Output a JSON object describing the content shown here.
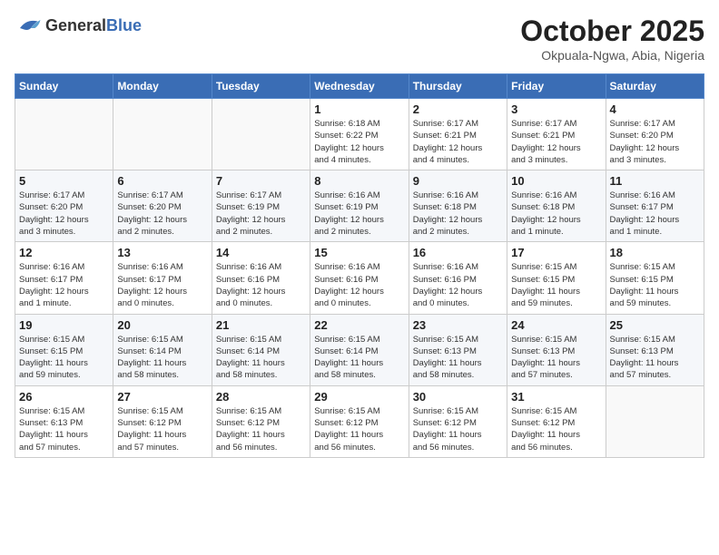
{
  "header": {
    "logo_general": "General",
    "logo_blue": "Blue",
    "month": "October 2025",
    "location": "Okpuala-Ngwa, Abia, Nigeria"
  },
  "weekdays": [
    "Sunday",
    "Monday",
    "Tuesday",
    "Wednesday",
    "Thursday",
    "Friday",
    "Saturday"
  ],
  "weeks": [
    [
      {
        "day": "",
        "info": ""
      },
      {
        "day": "",
        "info": ""
      },
      {
        "day": "",
        "info": ""
      },
      {
        "day": "1",
        "info": "Sunrise: 6:18 AM\nSunset: 6:22 PM\nDaylight: 12 hours\nand 4 minutes."
      },
      {
        "day": "2",
        "info": "Sunrise: 6:17 AM\nSunset: 6:21 PM\nDaylight: 12 hours\nand 4 minutes."
      },
      {
        "day": "3",
        "info": "Sunrise: 6:17 AM\nSunset: 6:21 PM\nDaylight: 12 hours\nand 3 minutes."
      },
      {
        "day": "4",
        "info": "Sunrise: 6:17 AM\nSunset: 6:20 PM\nDaylight: 12 hours\nand 3 minutes."
      }
    ],
    [
      {
        "day": "5",
        "info": "Sunrise: 6:17 AM\nSunset: 6:20 PM\nDaylight: 12 hours\nand 3 minutes."
      },
      {
        "day": "6",
        "info": "Sunrise: 6:17 AM\nSunset: 6:20 PM\nDaylight: 12 hours\nand 2 minutes."
      },
      {
        "day": "7",
        "info": "Sunrise: 6:17 AM\nSunset: 6:19 PM\nDaylight: 12 hours\nand 2 minutes."
      },
      {
        "day": "8",
        "info": "Sunrise: 6:16 AM\nSunset: 6:19 PM\nDaylight: 12 hours\nand 2 minutes."
      },
      {
        "day": "9",
        "info": "Sunrise: 6:16 AM\nSunset: 6:18 PM\nDaylight: 12 hours\nand 2 minutes."
      },
      {
        "day": "10",
        "info": "Sunrise: 6:16 AM\nSunset: 6:18 PM\nDaylight: 12 hours\nand 1 minute."
      },
      {
        "day": "11",
        "info": "Sunrise: 6:16 AM\nSunset: 6:17 PM\nDaylight: 12 hours\nand 1 minute."
      }
    ],
    [
      {
        "day": "12",
        "info": "Sunrise: 6:16 AM\nSunset: 6:17 PM\nDaylight: 12 hours\nand 1 minute."
      },
      {
        "day": "13",
        "info": "Sunrise: 6:16 AM\nSunset: 6:17 PM\nDaylight: 12 hours\nand 0 minutes."
      },
      {
        "day": "14",
        "info": "Sunrise: 6:16 AM\nSunset: 6:16 PM\nDaylight: 12 hours\nand 0 minutes."
      },
      {
        "day": "15",
        "info": "Sunrise: 6:16 AM\nSunset: 6:16 PM\nDaylight: 12 hours\nand 0 minutes."
      },
      {
        "day": "16",
        "info": "Sunrise: 6:16 AM\nSunset: 6:16 PM\nDaylight: 12 hours\nand 0 minutes."
      },
      {
        "day": "17",
        "info": "Sunrise: 6:15 AM\nSunset: 6:15 PM\nDaylight: 11 hours\nand 59 minutes."
      },
      {
        "day": "18",
        "info": "Sunrise: 6:15 AM\nSunset: 6:15 PM\nDaylight: 11 hours\nand 59 minutes."
      }
    ],
    [
      {
        "day": "19",
        "info": "Sunrise: 6:15 AM\nSunset: 6:15 PM\nDaylight: 11 hours\nand 59 minutes."
      },
      {
        "day": "20",
        "info": "Sunrise: 6:15 AM\nSunset: 6:14 PM\nDaylight: 11 hours\nand 58 minutes."
      },
      {
        "day": "21",
        "info": "Sunrise: 6:15 AM\nSunset: 6:14 PM\nDaylight: 11 hours\nand 58 minutes."
      },
      {
        "day": "22",
        "info": "Sunrise: 6:15 AM\nSunset: 6:14 PM\nDaylight: 11 hours\nand 58 minutes."
      },
      {
        "day": "23",
        "info": "Sunrise: 6:15 AM\nSunset: 6:13 PM\nDaylight: 11 hours\nand 58 minutes."
      },
      {
        "day": "24",
        "info": "Sunrise: 6:15 AM\nSunset: 6:13 PM\nDaylight: 11 hours\nand 57 minutes."
      },
      {
        "day": "25",
        "info": "Sunrise: 6:15 AM\nSunset: 6:13 PM\nDaylight: 11 hours\nand 57 minutes."
      }
    ],
    [
      {
        "day": "26",
        "info": "Sunrise: 6:15 AM\nSunset: 6:13 PM\nDaylight: 11 hours\nand 57 minutes."
      },
      {
        "day": "27",
        "info": "Sunrise: 6:15 AM\nSunset: 6:12 PM\nDaylight: 11 hours\nand 57 minutes."
      },
      {
        "day": "28",
        "info": "Sunrise: 6:15 AM\nSunset: 6:12 PM\nDaylight: 11 hours\nand 56 minutes."
      },
      {
        "day": "29",
        "info": "Sunrise: 6:15 AM\nSunset: 6:12 PM\nDaylight: 11 hours\nand 56 minutes."
      },
      {
        "day": "30",
        "info": "Sunrise: 6:15 AM\nSunset: 6:12 PM\nDaylight: 11 hours\nand 56 minutes."
      },
      {
        "day": "31",
        "info": "Sunrise: 6:15 AM\nSunset: 6:12 PM\nDaylight: 11 hours\nand 56 minutes."
      },
      {
        "day": "",
        "info": ""
      }
    ]
  ]
}
